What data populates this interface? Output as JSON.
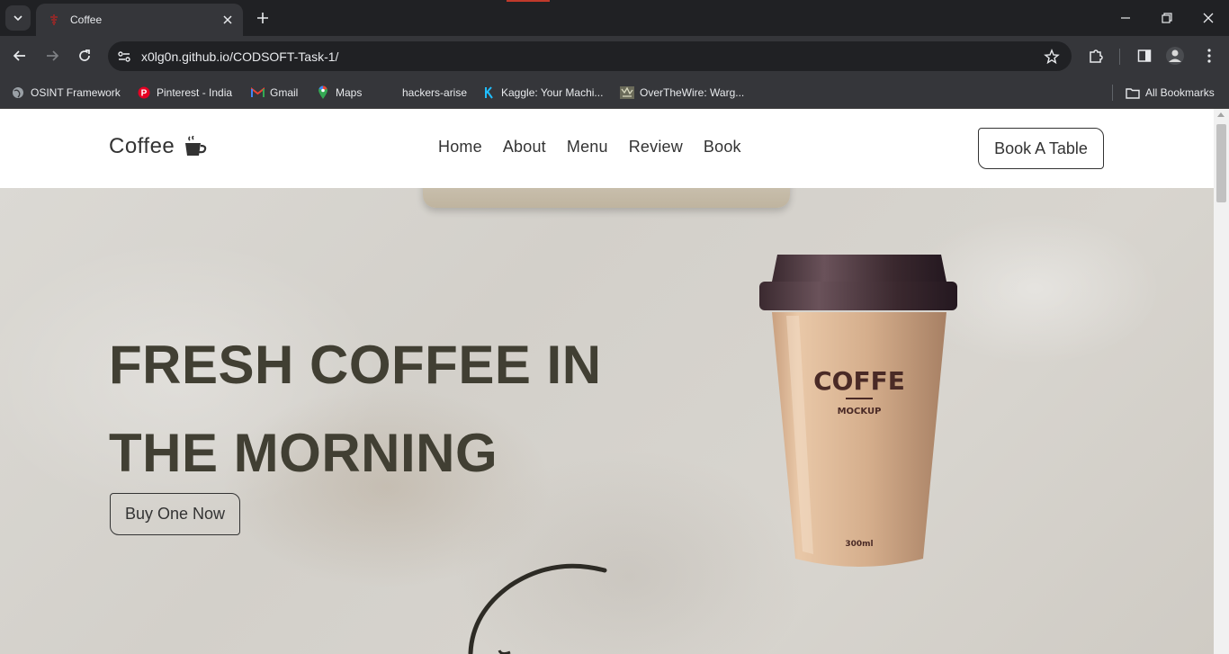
{
  "browser": {
    "tab_title": "Coffee",
    "url": "x0lg0n.github.io/CODSOFT-Task-1/",
    "bookmarks": [
      {
        "label": "OSINT Framework",
        "icon": "globe-icon"
      },
      {
        "label": "Pinterest - India",
        "icon": "pinterest-icon"
      },
      {
        "label": "Gmail",
        "icon": "gmail-icon"
      },
      {
        "label": "Maps",
        "icon": "maps-icon"
      },
      {
        "label": "hackers-arise",
        "icon": "blank-icon"
      },
      {
        "label": "Kaggle: Your Machi...",
        "icon": "kaggle-icon"
      },
      {
        "label": "OverTheWire: Warg...",
        "icon": "overthewire-icon"
      }
    ],
    "all_bookmarks": "All Bookmarks"
  },
  "site": {
    "logo_text": "Coffee",
    "nav": [
      "Home",
      "About",
      "Menu",
      "Review",
      "Book"
    ],
    "book_button": "Book A Table",
    "headline_line1": "FRESH COFFEE IN",
    "headline_line2": "THE MORNING",
    "buy_button": "Buy One Now",
    "cup_brand": "COFFE",
    "cup_sub": "MOCKUP",
    "cup_size": "300ml"
  },
  "colors": {
    "headline": "#413f33",
    "chrome_dark": "#202124",
    "chrome_toolbar": "#35363a"
  }
}
